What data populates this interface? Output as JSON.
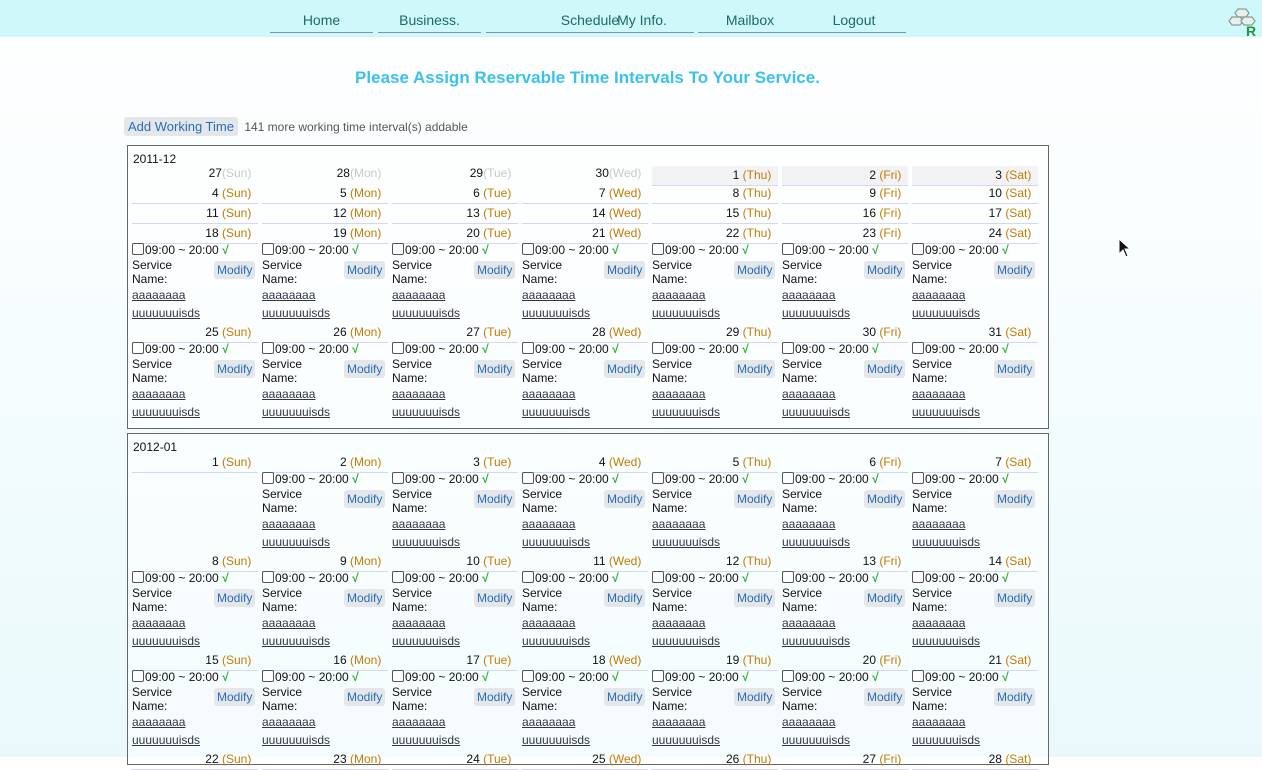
{
  "nav": {
    "items": [
      "Home",
      "Business.",
      "Schedule",
      "My Info.",
      "Mailbox",
      "Logout"
    ],
    "logo_icon": "app-logo-icon"
  },
  "page": {
    "title": "Please Assign Reservable Time Intervals To Your Service.",
    "add_button": "Add Working Time",
    "add_info": "141 more working time interval(s) addable"
  },
  "slot_template": {
    "time": "09:00 ~ 20:00",
    "check": "√",
    "service_label_1": "Service",
    "service_label_2": "Name:",
    "modify": "Modify",
    "link1": "aaaaaaaa",
    "link2": "uuuuuuuisds"
  },
  "months": [
    {
      "label": "2011-12",
      "weeks": [
        {
          "days": [
            [
              "27",
              "(Sun)",
              true
            ],
            [
              "28",
              "(Mon)",
              true
            ],
            [
              "29",
              "(Tue)",
              true
            ],
            [
              "30",
              "(Wed)",
              true
            ],
            [
              "1",
              "(Thu)",
              false
            ],
            [
              "2",
              "(Fri)",
              false
            ],
            [
              "3",
              "(Sat)",
              false
            ]
          ],
          "slots": []
        },
        {
          "days": [
            [
              "4",
              "(Sun)",
              false
            ],
            [
              "5",
              "(Mon)",
              false
            ],
            [
              "6",
              "(Tue)",
              false
            ],
            [
              "7",
              "(Wed)",
              false
            ],
            [
              "8",
              "(Thu)",
              false
            ],
            [
              "9",
              "(Fri)",
              false
            ],
            [
              "10",
              "(Sat)",
              false
            ]
          ],
          "slots": []
        },
        {
          "days": [
            [
              "11",
              "(Sun)",
              false
            ],
            [
              "12",
              "(Mon)",
              false
            ],
            [
              "13",
              "(Tue)",
              false
            ],
            [
              "14",
              "(Wed)",
              false
            ],
            [
              "15",
              "(Thu)",
              false
            ],
            [
              "16",
              "(Fri)",
              false
            ],
            [
              "17",
              "(Sat)",
              false
            ]
          ],
          "slots": []
        },
        {
          "days": [
            [
              "18",
              "(Sun)",
              false
            ],
            [
              "19",
              "(Mon)",
              false
            ],
            [
              "20",
              "(Tue)",
              false
            ],
            [
              "21",
              "(Wed)",
              false
            ],
            [
              "22",
              "(Thu)",
              false
            ],
            [
              "23",
              "(Fri)",
              false
            ],
            [
              "24",
              "(Sat)",
              false
            ]
          ],
          "slots": [
            0,
            1,
            2,
            3,
            4,
            5,
            6
          ]
        },
        {
          "days": [
            [
              "25",
              "(Sun)",
              false
            ],
            [
              "26",
              "(Mon)",
              false
            ],
            [
              "27",
              "(Tue)",
              false
            ],
            [
              "28",
              "(Wed)",
              false
            ],
            [
              "29",
              "(Thu)",
              false
            ],
            [
              "30",
              "(Fri)",
              false
            ],
            [
              "31",
              "(Sat)",
              false
            ]
          ],
          "slots": [
            0,
            1,
            2,
            3,
            4,
            5,
            6
          ]
        }
      ]
    },
    {
      "label": "2012-01",
      "weeks": [
        {
          "days": [
            [
              "1",
              "(Sun)",
              false
            ],
            [
              "2",
              "(Mon)",
              false
            ],
            [
              "3",
              "(Tue)",
              false
            ],
            [
              "4",
              "(Wed)",
              false
            ],
            [
              "5",
              "(Thu)",
              false
            ],
            [
              "6",
              "(Fri)",
              false
            ],
            [
              "7",
              "(Sat)",
              false
            ]
          ],
          "slots": [
            1,
            2,
            3,
            4,
            5,
            6
          ]
        },
        {
          "days": [
            [
              "8",
              "(Sun)",
              false
            ],
            [
              "9",
              "(Mon)",
              false
            ],
            [
              "10",
              "(Tue)",
              false
            ],
            [
              "11",
              "(Wed)",
              false
            ],
            [
              "12",
              "(Thu)",
              false
            ],
            [
              "13",
              "(Fri)",
              false
            ],
            [
              "14",
              "(Sat)",
              false
            ]
          ],
          "slots": [
            0,
            1,
            2,
            3,
            4,
            5,
            6
          ]
        },
        {
          "days": [
            [
              "15",
              "(Sun)",
              false
            ],
            [
              "16",
              "(Mon)",
              false
            ],
            [
              "17",
              "(Tue)",
              false
            ],
            [
              "18",
              "(Wed)",
              false
            ],
            [
              "19",
              "(Thu)",
              false
            ],
            [
              "20",
              "(Fri)",
              false
            ],
            [
              "21",
              "(Sat)",
              false
            ]
          ],
          "slots": [
            0,
            1,
            2,
            3,
            4,
            5,
            6
          ]
        },
        {
          "days": [
            [
              "22",
              "(Sun)",
              false
            ],
            [
              "23",
              "(Mon)",
              false
            ],
            [
              "24",
              "(Tue)",
              false
            ],
            [
              "25",
              "(Wed)",
              false
            ],
            [
              "26",
              "(Thu)",
              false
            ],
            [
              "27",
              "(Fri)",
              false
            ],
            [
              "28",
              "(Sat)",
              false
            ]
          ],
          "slots": []
        }
      ]
    }
  ]
}
